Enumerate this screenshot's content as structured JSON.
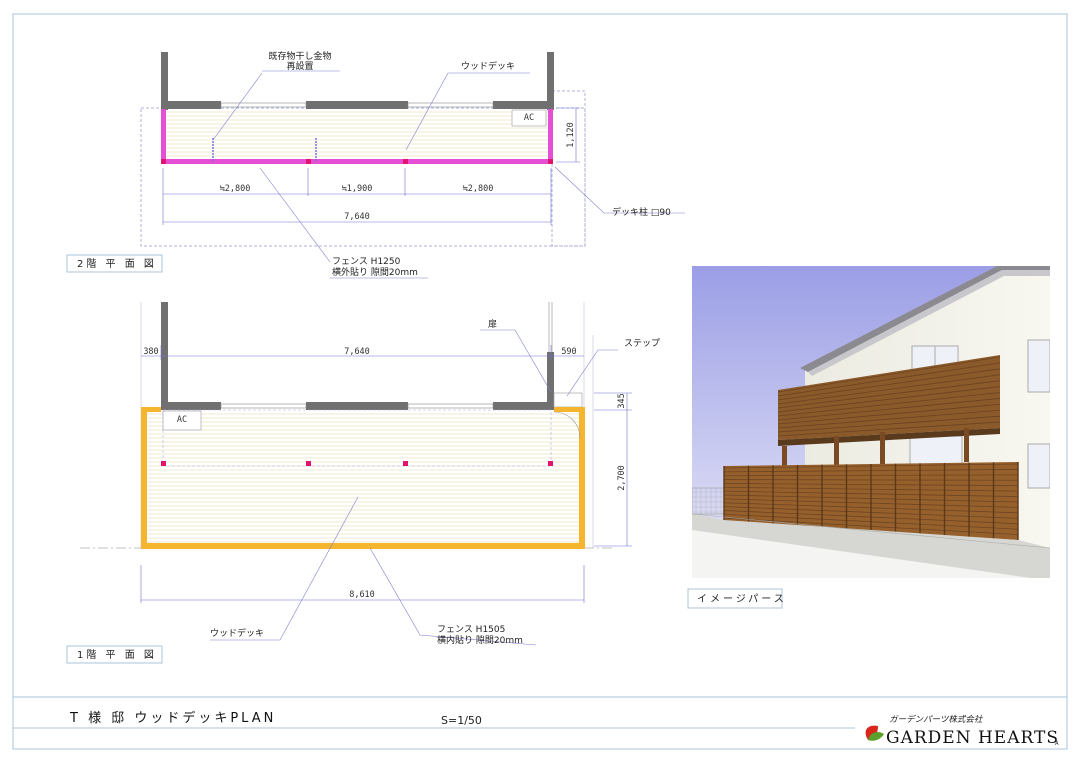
{
  "floor2": {
    "title": "2階 平 面 図",
    "labels": {
      "hanger_line1": "既存物干し金物",
      "hanger_line2": "再設置",
      "wooddeck": "ウッドデッキ",
      "ac": "AC",
      "post": "デッキ柱 □90",
      "fence_line1": "フェンス H1250",
      "fence_line2": "横外貼り 隙間20mm"
    },
    "dims": {
      "span1": "≒2,800",
      "span2": "≒1,900",
      "span3": "≒2,800",
      "total": "7,640",
      "depth": "1,120"
    }
  },
  "floor1": {
    "title": "1階 平 面 図",
    "labels": {
      "door": "扉",
      "step": "ステップ",
      "ac": "AC",
      "wooddeck": "ウッドデッキ",
      "fence_line1": "フェンス H1505",
      "fence_line2": "横内貼り 隙間20mm"
    },
    "dims": {
      "left": "380",
      "wall": "7,640",
      "right": "590",
      "step_depth": "345",
      "depth": "2,700",
      "total": "8,610"
    }
  },
  "perspective": {
    "title": "イメージパース"
  },
  "footer": {
    "plan_title": "T 様 邸 ウッドデッキPLAN",
    "scale": "S=1/50",
    "company_jp": "ガーデンパーツ株式会社",
    "company_en": "GARDEN HEARTS",
    "mark": "A"
  },
  "colors": {
    "deck_line": "#e6d2a6",
    "fence_floor2": "#e64fd4",
    "fence_floor1": "#f6b52e",
    "post": "#e0146e",
    "wall": "#707070",
    "dim_line": "#7070d0",
    "frame": "#a8c4dc",
    "brand_red": "#d9261c",
    "brand_green": "#5aa02c"
  }
}
